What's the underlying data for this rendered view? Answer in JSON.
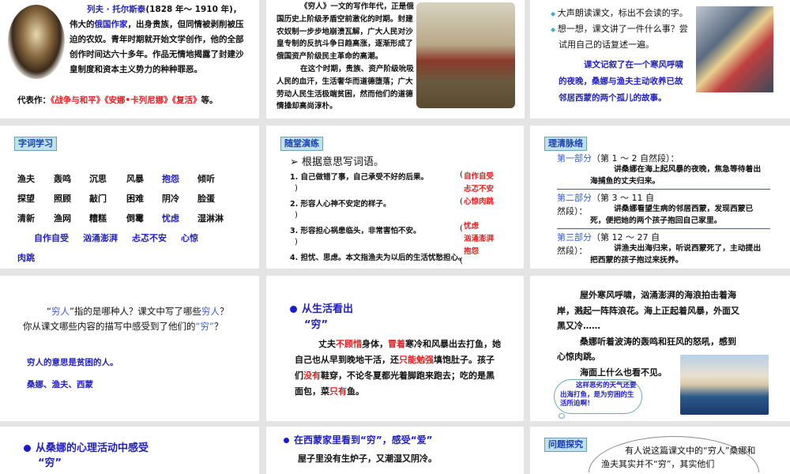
{
  "slide_tolstoy": {
    "name": "列夫 · 托尔斯泰",
    "dates": "(1828 年～ 1910 年)，",
    "t1": "伟大的",
    "country": "俄国作家",
    "t2": "，出身贵族，但同情被剥削被压迫的农奴。青年时期就开始文学创作，他的全部创作时间达六十多年。作品无情地揭露了封建沙皇制度和资本主义势力的种种罪恶。",
    "works_label": "代表作：",
    "works": [
      "《战争与和平》",
      "《安娜•卡列尼娜》",
      "《复活》"
    ],
    "works_end": "等。"
  },
  "slide_background": {
    "p1": "《穷人》一文的写作年代，正是俄国历史上阶级矛盾空前激化的时期。封建农奴制一步步地崩溃瓦解，广大人民对沙皇专制的反抗斗争日趋高涨，逐渐形成了俄国资产阶级民主革命的高潮。",
    "p2": "在这个时期，贵族、资产阶级吮吸人民的血汗，生活奢华而道德堕落；广大劳动人民生活极端贫困，然而他们的道德情操却高尚淳朴。"
  },
  "slide_reading": {
    "bullets": [
      "大声朗读课文，标出不会读的字。",
      "想一想，课文讲了一件什么事？尝试用自己的话复述一遍。"
    ],
    "summary": "课文记叙了在一个寒风呼啸的夜晚，桑娜与渔夫主动收养已故邻居西蒙的两个孤儿的故事。"
  },
  "slide_words": {
    "label": "字词学习",
    "rows": [
      [
        "渔夫",
        "轰鸣",
        "沉思",
        "风暴",
        "抱怨",
        "倾听"
      ],
      [
        "探望",
        "照顾",
        "敲门",
        "困难",
        "阴冷",
        "脸蛋"
      ],
      [
        "清新",
        "渔网",
        "糟糕",
        "倒霉",
        "忧虑",
        "湿淋淋"
      ]
    ],
    "idioms": [
      "自作自受",
      "汹涌澎湃",
      "忐忑不安",
      "心惊"
    ],
    "idiom_tail": "肉跳"
  },
  "slide_exercise": {
    "label": "随堂演练",
    "heading": "根据意思写词语。",
    "items": [
      "1. 自己做错了事，自己承受不好的后果。",
      "2. 形容人心神不安定的样子。",
      "3. 形容担心祸患临头，非常害怕不安。",
      "4. 担忧、思虑。本文指渔夫为以后的生活忧愁担心。"
    ],
    "open_paren": "(",
    "close_paren": ")",
    "answers": [
      "自作自受",
      "忐忑不安",
      "心惊肉跳",
      "忧虑",
      "汹涌澎湃",
      "抱怨"
    ]
  },
  "slide_structure": {
    "label": "理清脉络",
    "parts": [
      {
        "title": "第一部分",
        "range": "（第 1 ～ 2 自然段）：",
        "desc": "讲桑娜在海上起风暴的夜晚，焦急等待着出海捕鱼的丈夫归来。"
      },
      {
        "title": "第二部分",
        "range": "（第 3 ～ 11 自然段）：",
        "desc": "讲桑娜看望生病的邻居西蒙，发现西蒙已死，便把她的两个孩子抱回自己家里。"
      },
      {
        "title": "第三部分",
        "range": "（第 12 ～ 27 自然段）：",
        "desc": "讲渔夫出海归来，听说西蒙死了，主动提出把西蒙的孩子抱过来抚养。"
      }
    ]
  },
  "slide_question": {
    "q": [
      "“",
      "穷人",
      "”指的是哪种人？课文中写了哪些",
      "穷人",
      "？你从课文哪些内容的描写中感受到了他们的",
      "“穷”",
      "？"
    ],
    "a1": "穷人的意思是贫困的人。",
    "a2": "桑娜、渔夫、西蒙"
  },
  "slide_life": {
    "heading": "从生活看出",
    "heading2": "“穷”",
    "segs": [
      "丈夫",
      "不顾惜",
      "身体，",
      "冒着",
      "寒冷和风暴出去打鱼，她自己也从早到晚地干活，还",
      "只能勉强",
      "填饱肚子。孩子们",
      "没有",
      "鞋穿，不论冬夏都光着脚跑来跑去；吃的是黑面包，菜",
      "只有",
      "鱼。"
    ]
  },
  "slide_storm": {
    "p1": "屋外寒风呼啸，汹涌澎湃的海浪拍击着海岸，溅起一阵阵浪花。海上正起着风暴，外面又黑又冷……",
    "p2": "桑娜听着波涛的轰鸣和狂风的怒吼，感到心惊肉跳。",
    "p3": "海面上什么也看不见。",
    "bubble": "这样恶劣的天气还要出海打鱼，是为穷困的生活所迫啊！"
  },
  "slide_mind": {
    "heading": "从桑娜的心理活动中感受",
    "heading2": "“穷”"
  },
  "slide_love": {
    "heading": "在西蒙家里看到“穷”，感受“爱”",
    "line1": "屋子里没有生炉子，又潮湿又阴冷。"
  },
  "slide_inquiry": {
    "label": "问题探究",
    "text": "有人说这篇课文中的“穷人”桑娜和渔夫其实并不“穷”，其实他们"
  }
}
